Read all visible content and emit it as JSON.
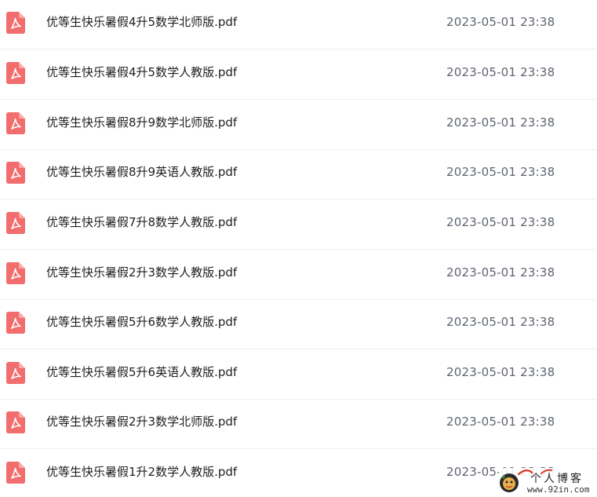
{
  "files": [
    {
      "name": "优等生快乐暑假4升5数学北师版.pdf",
      "date": "2023-05-01 23:38"
    },
    {
      "name": "优等生快乐暑假4升5数学人教版.pdf",
      "date": "2023-05-01 23:38"
    },
    {
      "name": "优等生快乐暑假8升9数学北师版.pdf",
      "date": "2023-05-01 23:38"
    },
    {
      "name": "优等生快乐暑假8升9英语人教版.pdf",
      "date": "2023-05-01 23:38"
    },
    {
      "name": "优等生快乐暑假7升8数学人教版.pdf",
      "date": "2023-05-01 23:38"
    },
    {
      "name": "优等生快乐暑假2升3数学人教版.pdf",
      "date": "2023-05-01 23:38"
    },
    {
      "name": "优等生快乐暑假5升6数学人教版.pdf",
      "date": "2023-05-01 23:38"
    },
    {
      "name": "优等生快乐暑假5升6英语人教版.pdf",
      "date": "2023-05-01 23:38"
    },
    {
      "name": "优等生快乐暑假2升3数学北师版.pdf",
      "date": "2023-05-01 23:38"
    },
    {
      "name": "优等生快乐暑假1升2数学人教版.pdf",
      "date": "2023-05-01 23:38"
    }
  ],
  "watermark": {
    "title": "个人博客",
    "url": "www.92in.com"
  },
  "icon": "pdf-file-icon",
  "colors": {
    "pdf_icon": "#f26d6d",
    "divider": "#eeeff1",
    "name_text": "#1f1f1f",
    "date_text": "#5e6470"
  }
}
